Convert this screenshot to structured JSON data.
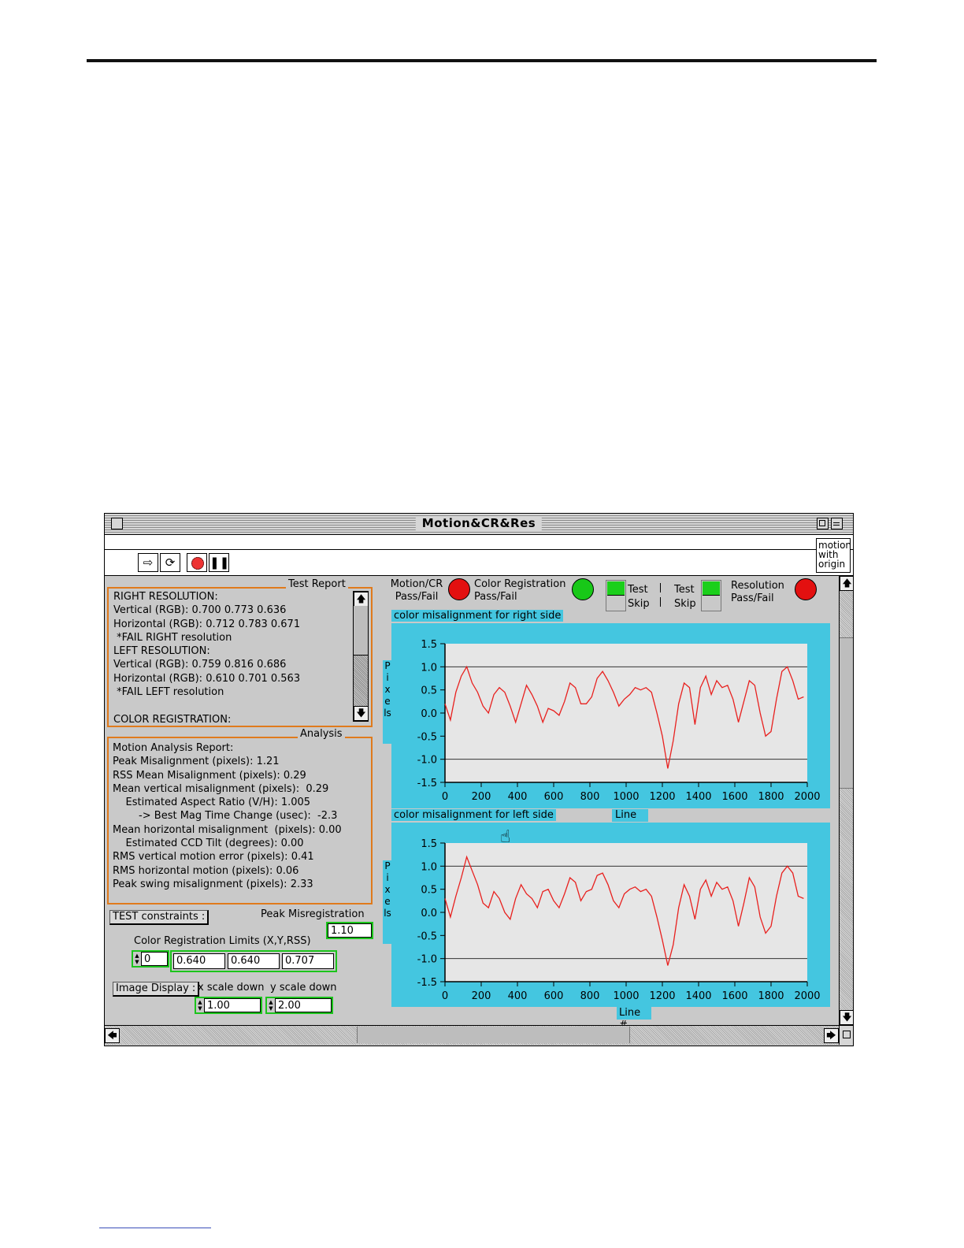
{
  "window": {
    "title": "Motion&CR&Res",
    "motion_box_lines": [
      "motion",
      "with",
      "origin"
    ]
  },
  "toolbar": {
    "run_icon": "run-arrow-icon",
    "continuous_icon": "continuous-run-icon",
    "stop_icon": "stop-icon",
    "pause_icon": "pause-icon"
  },
  "test_report": {
    "label": "Test Report",
    "lines": [
      "RIGHT RESOLUTION:",
      "Vertical (RGB): 0.700 0.773 0.636",
      "Horizontal (RGB): 0.712 0.783 0.671",
      " *FAIL RIGHT resolution",
      "LEFT RESOLUTION:",
      "Vertical (RGB): 0.759 0.816 0.686",
      "Horizontal (RGB): 0.610 0.701 0.563",
      " *FAIL LEFT resolution",
      "",
      "COLOR REGISTRATION:"
    ]
  },
  "analysis": {
    "label": "Analysis",
    "lines": [
      "Motion Analysis Report:",
      "Peak Misalignment (pixels): 1.21",
      "RSS Mean Misalignment (pixels): 0.29",
      "Mean vertical misalignment (pixels):  0.29",
      "    Estimated Aspect Ratio (V/H): 1.005",
      "        -> Best Mag Time Change (usec):  -2.3",
      "Mean horizontal misalignment  (pixels): 0.00",
      "    Estimated CCD Tilt (degrees): 0.00",
      "RMS vertical motion error (pixels): 0.41",
      "RMS horizontal motion (pixels): 0.06",
      "Peak swing misalignment (pixels): 2.33"
    ]
  },
  "constraints": {
    "button_label": "TEST constraints :",
    "peak_label": "Peak  Misregistration",
    "peak_value": "1.10",
    "limits_label": "Color Registration Limits (X,Y,RSS)",
    "index_value": "0",
    "limit_x": "0.640",
    "limit_y": "0.640",
    "limit_rss": "0.707"
  },
  "image_display": {
    "button_label": "Image Display :",
    "x_label": "x scale down",
    "y_label": "y scale down",
    "x_value": "1.00",
    "y_value": "2.00"
  },
  "indicators": {
    "motion_label_1": "Motion/CR",
    "motion_label_2": "Pass/Fail",
    "motion_color": "#e31010",
    "color_reg_label_1": "Color Registration",
    "color_reg_label_2": "Pass/Fail",
    "color_reg_color": "#18c818",
    "test_label": "Test",
    "skip_label": "Skip",
    "resolution_label_1": "Resolution",
    "resolution_label_2": "Pass/Fail",
    "resolution_color": "#e31010"
  },
  "chart_data": [
    {
      "type": "line",
      "title": "color misalignment for right side",
      "xlabel": "Line #",
      "ylabel": "Pixels",
      "xlim": [
        0,
        2000
      ],
      "ylim": [
        -1.5,
        1.5
      ],
      "x_ticks": [
        0,
        200,
        400,
        600,
        800,
        1000,
        1200,
        1400,
        1600,
        1800,
        2000
      ],
      "y_ticks": [
        "1.5",
        "1.0",
        "0.5",
        "0.0",
        "-0.5",
        "-1.0",
        "-1.5"
      ],
      "gridlines_y": [
        1.0,
        -1.0
      ],
      "line_color": "#e8201e",
      "series": [
        {
          "x": [
            0,
            30,
            60,
            90,
            120,
            150,
            180,
            210,
            240,
            270,
            300,
            330,
            360,
            390,
            420,
            450,
            480,
            510,
            540,
            570,
            600,
            630,
            660,
            690,
            720,
            750,
            780,
            810,
            840,
            870,
            900,
            930,
            960,
            990,
            1020,
            1050,
            1080,
            1110,
            1140,
            1170,
            1200,
            1230,
            1260,
            1290,
            1320,
            1350,
            1380,
            1410,
            1440,
            1470,
            1500,
            1530,
            1560,
            1590,
            1620,
            1650,
            1680,
            1710,
            1740,
            1770,
            1800,
            1830,
            1860,
            1890,
            1920,
            1950,
            1980
          ],
          "y": [
            0.2,
            -0.15,
            0.45,
            0.8,
            1.0,
            0.65,
            0.45,
            0.15,
            0.0,
            0.4,
            0.55,
            0.45,
            0.15,
            -0.2,
            0.2,
            0.6,
            0.4,
            0.15,
            -0.2,
            0.1,
            0.05,
            -0.05,
            0.25,
            0.65,
            0.55,
            0.2,
            0.2,
            0.35,
            0.75,
            0.9,
            0.7,
            0.45,
            0.15,
            0.3,
            0.4,
            0.55,
            0.5,
            0.55,
            0.45,
            0.0,
            -0.5,
            -1.2,
            -0.6,
            0.2,
            0.65,
            0.55,
            -0.25,
            0.55,
            0.8,
            0.4,
            0.7,
            0.55,
            0.6,
            0.3,
            -0.2,
            0.25,
            0.7,
            0.6,
            0.0,
            -0.5,
            -0.4,
            0.3,
            0.9,
            1.0,
            0.7,
            0.3,
            0.35
          ]
        }
      ]
    },
    {
      "type": "line",
      "title": "color misalignment for left side",
      "xlabel": "Line #",
      "ylabel": "Pixels",
      "xlim": [
        0,
        2000
      ],
      "ylim": [
        -1.5,
        1.5
      ],
      "x_ticks": [
        0,
        200,
        400,
        600,
        800,
        1000,
        1200,
        1400,
        1600,
        1800,
        2000
      ],
      "y_ticks": [
        "1.5",
        "1.0",
        "0.5",
        "0.0",
        "-0.5",
        "-1.0",
        "-1.5"
      ],
      "gridlines_y": [
        1.0,
        -1.0
      ],
      "line_color": "#e8201e",
      "series": [
        {
          "x": [
            0,
            30,
            60,
            90,
            120,
            150,
            180,
            210,
            240,
            270,
            300,
            330,
            360,
            390,
            420,
            450,
            480,
            510,
            540,
            570,
            600,
            630,
            660,
            690,
            720,
            750,
            780,
            810,
            840,
            870,
            900,
            930,
            960,
            990,
            1020,
            1050,
            1080,
            1110,
            1140,
            1170,
            1200,
            1230,
            1260,
            1290,
            1320,
            1350,
            1380,
            1410,
            1440,
            1470,
            1500,
            1530,
            1560,
            1590,
            1620,
            1650,
            1680,
            1710,
            1740,
            1770,
            1800,
            1830,
            1860,
            1890,
            1920,
            1950,
            1980
          ],
          "y": [
            0.3,
            -0.1,
            0.35,
            0.75,
            1.2,
            0.9,
            0.6,
            0.2,
            0.1,
            0.45,
            0.3,
            0.0,
            -0.15,
            0.3,
            0.6,
            0.4,
            0.3,
            0.1,
            0.45,
            0.5,
            0.25,
            0.1,
            0.4,
            0.75,
            0.65,
            0.25,
            0.45,
            0.5,
            0.8,
            0.85,
            0.6,
            0.25,
            0.1,
            0.4,
            0.5,
            0.55,
            0.45,
            0.5,
            0.35,
            -0.1,
            -0.6,
            -1.15,
            -0.7,
            0.1,
            0.6,
            0.35,
            -0.15,
            0.5,
            0.7,
            0.35,
            0.65,
            0.5,
            0.55,
            0.25,
            -0.3,
            0.2,
            0.75,
            0.55,
            -0.1,
            -0.45,
            -0.3,
            0.35,
            0.85,
            1.0,
            0.85,
            0.35,
            0.3
          ]
        }
      ]
    }
  ]
}
